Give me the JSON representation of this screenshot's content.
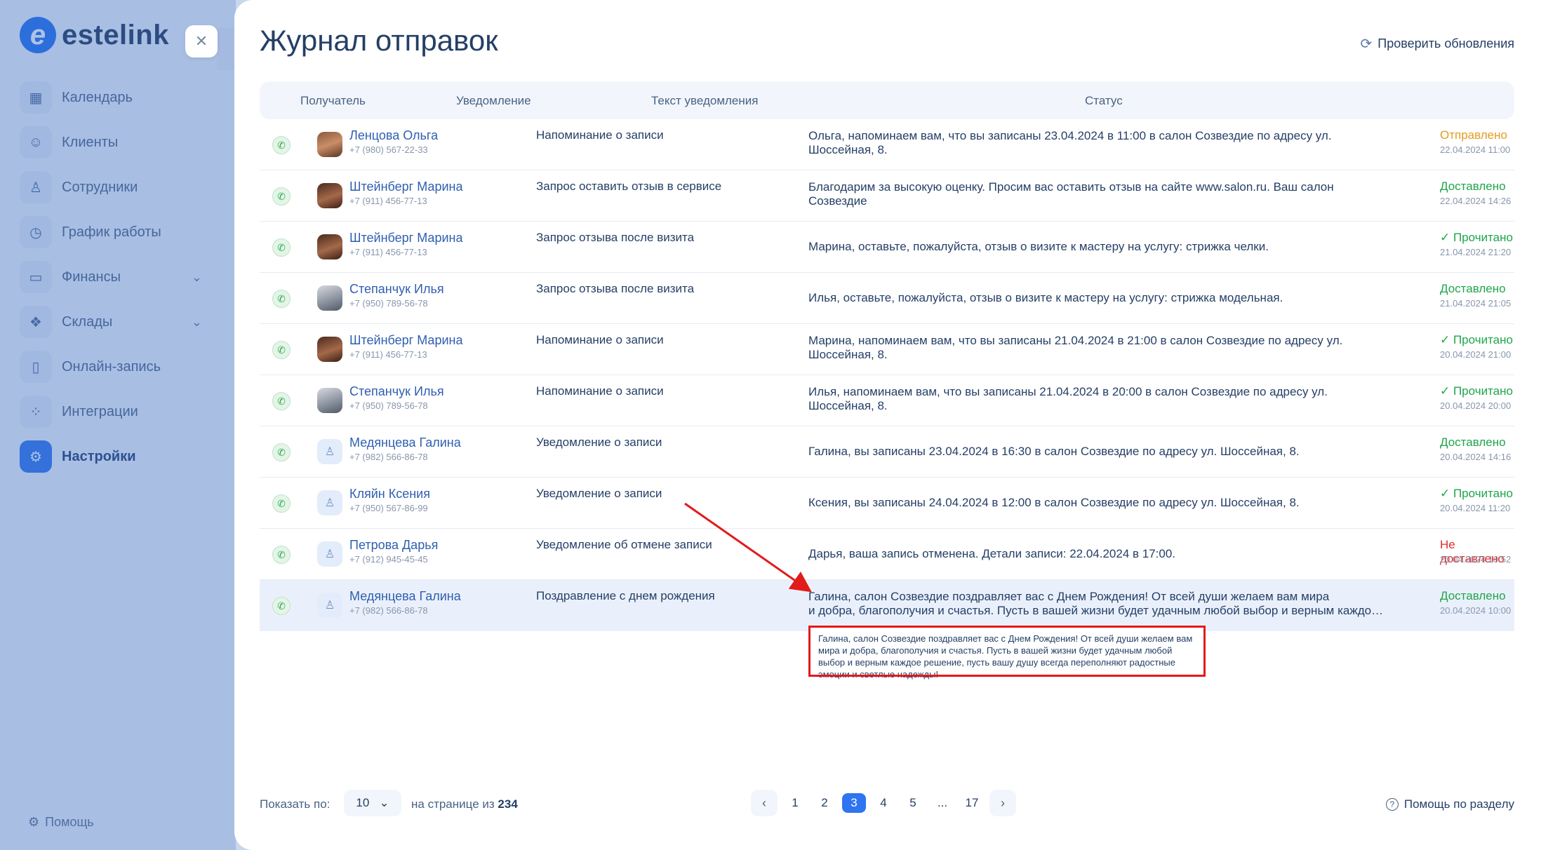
{
  "sidebar": {
    "logo_text": "estelink",
    "logo_mark": "e",
    "items": [
      {
        "label": "Календарь",
        "icon": "calendar-icon",
        "glyph": "▦"
      },
      {
        "label": "Клиенты",
        "icon": "users-icon",
        "glyph": "☺"
      },
      {
        "label": "Сотрудники",
        "icon": "user-icon",
        "glyph": "♙"
      },
      {
        "label": "График работы",
        "icon": "clock-icon",
        "glyph": "◷"
      },
      {
        "label": "Финансы",
        "icon": "wallet-icon",
        "glyph": "▭"
      },
      {
        "label": "Склады",
        "icon": "boxes-icon",
        "glyph": "❖"
      },
      {
        "label": "Онлайн-запись",
        "icon": "phone-icon",
        "glyph": "▯"
      },
      {
        "label": "Интеграции",
        "icon": "grid-icon",
        "glyph": "⁘"
      },
      {
        "label": "Настройки",
        "icon": "gear-icon",
        "glyph": "⚙"
      }
    ],
    "help": "Помощь",
    "close_glyph": "✕"
  },
  "header": {
    "title": "Журнал отправок",
    "check_updates": "Проверить обновления"
  },
  "table": {
    "columns": [
      "Получатель",
      "Уведомление",
      "Текст уведомления",
      "Статус"
    ],
    "rows": [
      {
        "name": "Ленцова Ольга",
        "phone": "+7 (980) 567-22-33",
        "avatar": "photo-f1",
        "notification": "Напоминание о записи",
        "text": "Ольга, напоминаем вам, что вы записаны 23.04.2024 в 11:00 в салон Созвездие по адресу ул.",
        "text2": "Шоссейная, 8.",
        "status": "Отправлено",
        "status_class": "st-orange",
        "date": "22.04.2024   11:00"
      },
      {
        "name": "Штейнберг Марина",
        "phone": "+7 (911) 456-77-13",
        "avatar": "photo-f2",
        "notification": "Запрос оставить отзыв в сервисе",
        "text": "Благодарим за высокую оценку. Просим вас оставить отзыв на сайте www.salon.ru. Ваш салон",
        "text2": "Созвездие",
        "status": "Доставлено",
        "status_class": "st-green",
        "date": "22.04.2024   14:26"
      },
      {
        "name": "Штейнберг Марина",
        "phone": "+7 (911) 456-77-13",
        "avatar": "photo-f2",
        "notification": "Запрос отзыва после визита",
        "text": "Марина, оставьте, пожалуйста, отзыв о визите к мастеру на услугу: стрижка челки.",
        "text2": "",
        "status": "✓ Прочитано",
        "status_class": "st-green",
        "date": "21.04.2024   21:20"
      },
      {
        "name": "Степанчук Илья",
        "phone": "+7 (950) 789-56-78",
        "avatar": "photo-m",
        "notification": "Запрос отзыва после визита",
        "text": "Илья, оставьте, пожалуйста, отзыв о визите к мастеру на услугу: стрижка модельная.",
        "text2": "",
        "status": "Доставлено",
        "status_class": "st-green",
        "date": "21.04.2024   21:05"
      },
      {
        "name": "Штейнберг Марина",
        "phone": "+7 (911) 456-77-13",
        "avatar": "photo-f2",
        "notification": "Напоминание о записи",
        "text": "Марина, напоминаем вам, что вы записаны 21.04.2024 в 21:00 в салон Созвездие по адресу ул.",
        "text2": "Шоссейная, 8.",
        "status": "✓ Прочитано",
        "status_class": "st-green",
        "date": "20.04.2024   21:00"
      },
      {
        "name": "Степанчук Илья",
        "phone": "+7 (950) 789-56-78",
        "avatar": "photo-m",
        "notification": "Напоминание о записи",
        "text": "Илья, напоминаем вам, что вы записаны 21.04.2024 в 20:00 в салон Созвездие по адресу ул.",
        "text2": "Шоссейная, 8.",
        "status": "✓ Прочитано",
        "status_class": "st-green",
        "date": "20.04.2024   20:00"
      },
      {
        "name": "Медянцева Галина",
        "phone": "+7 (982) 566-86-78",
        "avatar": "placeholder",
        "notification": "Уведомление о записи",
        "text": "Галина, вы записаны 23.04.2024 в 16:30 в салон Созвездие по адресу ул. Шоссейная, 8.",
        "text2": "",
        "status": "Доставлено",
        "status_class": "st-green",
        "date": "20.04.2024   14:16"
      },
      {
        "name": "Кляйн Ксения",
        "phone": "+7 (950) 567-86-99",
        "avatar": "placeholder",
        "notification": "Уведомление о записи",
        "text": "Ксения, вы записаны 24.04.2024 в 12:00 в салон Созвездие по адресу ул. Шоссейная, 8.",
        "text2": "",
        "status": "✓ Прочитано",
        "status_class": "st-green",
        "date": "20.04.2024   11:20"
      },
      {
        "name": "Петрова Дарья",
        "phone": "+7 (912) 945-45-45",
        "avatar": "placeholder",
        "notification": "Уведомление об отмене записи",
        "text": "Дарья, ваша запись отменена. Детали записи: 22.04.2024 в 17:00.",
        "text2": "",
        "status": "Не доставлено",
        "status_class": "st-red",
        "date": "20.04.2024   10:52"
      },
      {
        "name": "Медянцева Галина",
        "phone": "+7 (982) 566-86-78",
        "avatar": "placeholder",
        "notification": "Поздравление с днем рождения",
        "text": "Галина, салон Созвездие поздравляет вас с Днем Рождения! От всей души желаем вам мира",
        "text2": "и добра, благополучия и счастья. Пусть в вашей жизни будет удачным любой выбор и верным каждое решение",
        "status": "Доставлено",
        "status_class": "st-green",
        "date": "20.04.2024   10:00"
      }
    ]
  },
  "tooltip": {
    "text": "Галина, салон Созвездие поздравляет вас с Днем Рождения! От всей души желаем вам мира и добра, благополучия и счастья. Пусть в вашей жизни будет удачным любой выбор и верным каждое решение, пусть вашу душу всегда переполняют радостные эмоции и светлые надежды!"
  },
  "footer": {
    "show_label": "Показать по:",
    "per_page_value": "10",
    "per_page_text": "на странице из",
    "total": "234",
    "pages": [
      "1",
      "2",
      "3",
      "4",
      "5",
      "...",
      "17"
    ],
    "current_page": "3",
    "help": "Помощь по разделу"
  },
  "colors": {
    "accent": "#2f74f0",
    "sent": "#e69a1d",
    "delivered": "#1fa64a",
    "failed": "#e02c2c",
    "annotation": "#e21a1a"
  }
}
